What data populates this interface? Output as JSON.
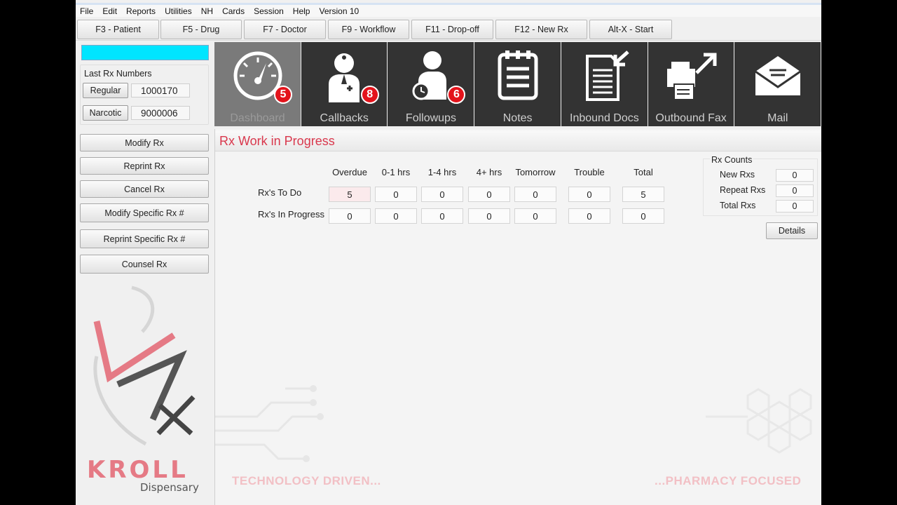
{
  "menu": [
    "File",
    "Edit",
    "Reports",
    "Utilities",
    "NH",
    "Cards",
    "Session",
    "Help",
    "Version 10"
  ],
  "toolbar": [
    "F3 - Patient",
    "F5 - Drug",
    "F7 - Doctor",
    "F9 - Workflow",
    "F11 - Drop-off",
    "F12 - New Rx",
    "Alt-X - Start"
  ],
  "left": {
    "search_value": "",
    "last_rx_title": "Last Rx Numbers",
    "regular_label": "Regular",
    "regular_value": "1000170",
    "narcotic_label": "Narcotic",
    "narcotic_value": "9000006",
    "actions": [
      "Modify Rx",
      "Reprint Rx",
      "Cancel Rx",
      "Modify Specific Rx #",
      "Reprint Specific Rx #",
      "Counsel Rx"
    ],
    "logo_text": "KROLL",
    "logo_sub": "Dispensary"
  },
  "tiles": [
    {
      "label": "Dashboard",
      "icon": "gauge-icon",
      "badge": "5",
      "active": true
    },
    {
      "label": "Callbacks",
      "icon": "doctor-icon",
      "badge": "8"
    },
    {
      "label": "Followups",
      "icon": "person-clock-icon",
      "badge": "6"
    },
    {
      "label": "Notes",
      "icon": "notepad-icon",
      "badge": ""
    },
    {
      "label": "Inbound Docs",
      "icon": "inbound-doc-icon",
      "badge": ""
    },
    {
      "label": "Outbound Fax",
      "icon": "fax-icon",
      "badge": ""
    },
    {
      "label": "Mail",
      "icon": "mail-icon",
      "badge": ""
    }
  ],
  "main": {
    "title": "Rx Work in Progress",
    "columns": [
      "Overdue",
      "0-1 hrs",
      "1-4 hrs",
      "4+ hrs",
      "Tomorrow",
      "Trouble",
      "Total"
    ],
    "rows": [
      {
        "label": "Rx's To Do",
        "values": [
          "5",
          "0",
          "0",
          "0",
          "0",
          "0",
          "5"
        ]
      },
      {
        "label": "Rx's In Progress",
        "values": [
          "0",
          "0",
          "0",
          "0",
          "0",
          "0",
          "0"
        ]
      }
    ],
    "counts_title": "Rx Counts",
    "counts": [
      {
        "label": "New Rxs",
        "value": "0"
      },
      {
        "label": "Repeat Rxs",
        "value": "0"
      },
      {
        "label": "Total Rxs",
        "value": "0"
      }
    ],
    "details_label": "Details",
    "slogan_left": "TECHNOLOGY DRIVEN...",
    "slogan_right": "...PHARMACY FOCUSED"
  },
  "colors": {
    "accent": "#d9384d",
    "search_bg": "#00e5ff",
    "badge": "#e3131b",
    "tile_bg": "#333333"
  }
}
